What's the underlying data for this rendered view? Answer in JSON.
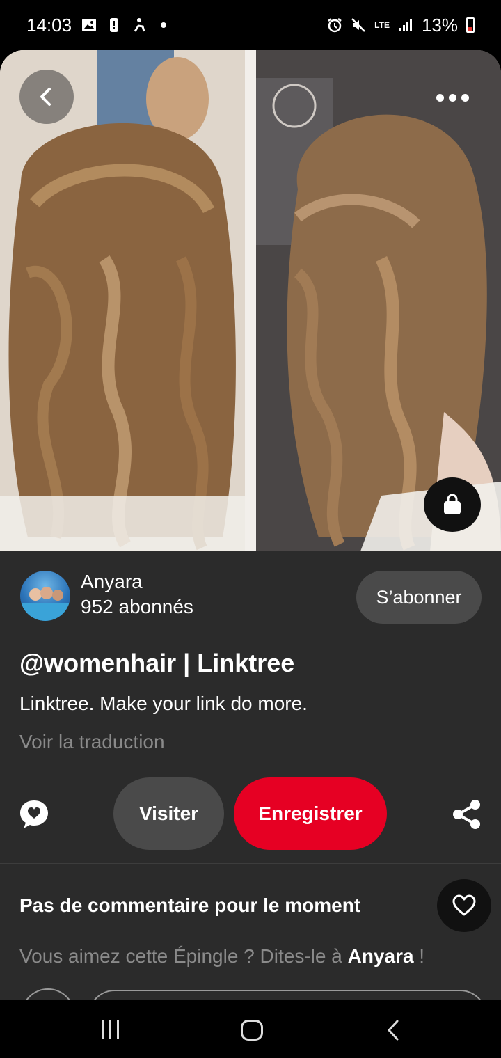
{
  "status_bar": {
    "time": "14:03",
    "network": "LTE",
    "battery_percent": "13%",
    "icons": [
      "gallery-icon",
      "notification-icon",
      "accessibility-icon",
      "dot-icon",
      "alarm-icon",
      "mute-icon",
      "signal-icon",
      "battery-icon"
    ]
  },
  "pin": {
    "image_description_icon": "hairstyle-photo",
    "creator": {
      "name": "Anyara",
      "followers": "952 abonnés",
      "follow_label": "S’abonner"
    },
    "title": "@womenhair | Linktree",
    "description": "Linktree. Make your link do more.",
    "translate_label": "Voir la traduction"
  },
  "actions": {
    "visit_label": "Visiter",
    "save_label": "Enregistrer"
  },
  "comments": {
    "empty_label": "Pas de commentaire pour le moment",
    "prompt_prefix": "Vous aimez cette Épingle ? Dites-le à ",
    "prompt_name": "Anyara",
    "prompt_suffix": " !"
  },
  "colors": {
    "background": "#2b2b2b",
    "save_button": "#e60023",
    "secondary_button": "#4a4a4a",
    "muted_text": "#8a8a8a"
  }
}
